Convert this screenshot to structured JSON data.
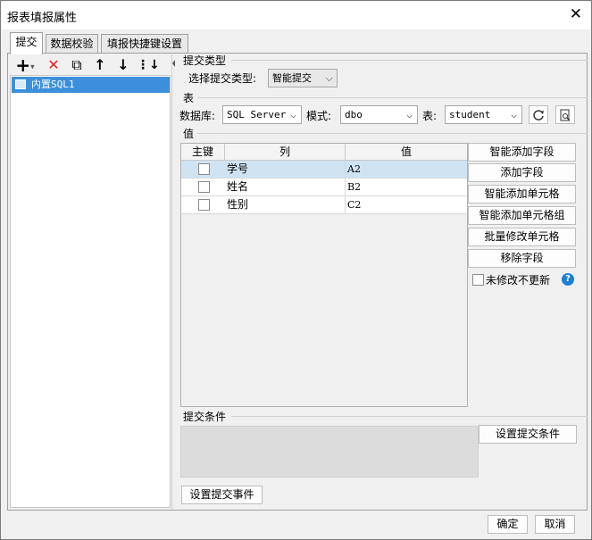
{
  "window": {
    "title": "报表填报属性",
    "close_glyph": "✕"
  },
  "tabs": [
    {
      "label": "提交",
      "active": true
    },
    {
      "label": "数据校验",
      "active": false
    },
    {
      "label": "填报快捷键设置",
      "active": false
    }
  ],
  "toolbar": {
    "add": "+",
    "add_arrow": "▾",
    "delete": "✕",
    "copy": "⧉",
    "up": "↑",
    "down": "↓",
    "more": "⋮↓"
  },
  "sql_list": {
    "items": [
      "内置SQL1"
    ]
  },
  "submit_type": {
    "section_label": "提交类型",
    "label": "选择提交类型:",
    "value": "智能提交"
  },
  "table_section": {
    "section_label": "表",
    "db_label": "数据库:",
    "db_value": "SQL Server",
    "schema_label": "模式:",
    "schema_value": "dbo",
    "table_label": "表:",
    "table_value": "student"
  },
  "value_section": {
    "section_label": "值",
    "columns": [
      "主键",
      "列",
      "值"
    ],
    "rows": [
      {
        "key": false,
        "column": "学号",
        "value": "A2",
        "selected": true
      },
      {
        "key": false,
        "column": "姓名",
        "value": "B2",
        "selected": false
      },
      {
        "key": false,
        "column": "性别",
        "value": "C2",
        "selected": false
      }
    ],
    "buttons": [
      "智能添加字段",
      "添加字段",
      "智能添加单元格",
      "智能添加单元格组",
      "批量修改单元格",
      "移除字段"
    ],
    "no_update_label": "未修改不更新",
    "help_glyph": "?"
  },
  "condition_section": {
    "section_label": "提交条件",
    "set_condition_button": "设置提交条件"
  },
  "event_button": "设置提交事件",
  "footer": {
    "ok": "确定",
    "cancel": "取消"
  },
  "colors": {
    "selection": "#3c8fdb",
    "row_selected": "#cfe3f3",
    "help": "#1f7fd6",
    "delete_red": "#e02020"
  }
}
